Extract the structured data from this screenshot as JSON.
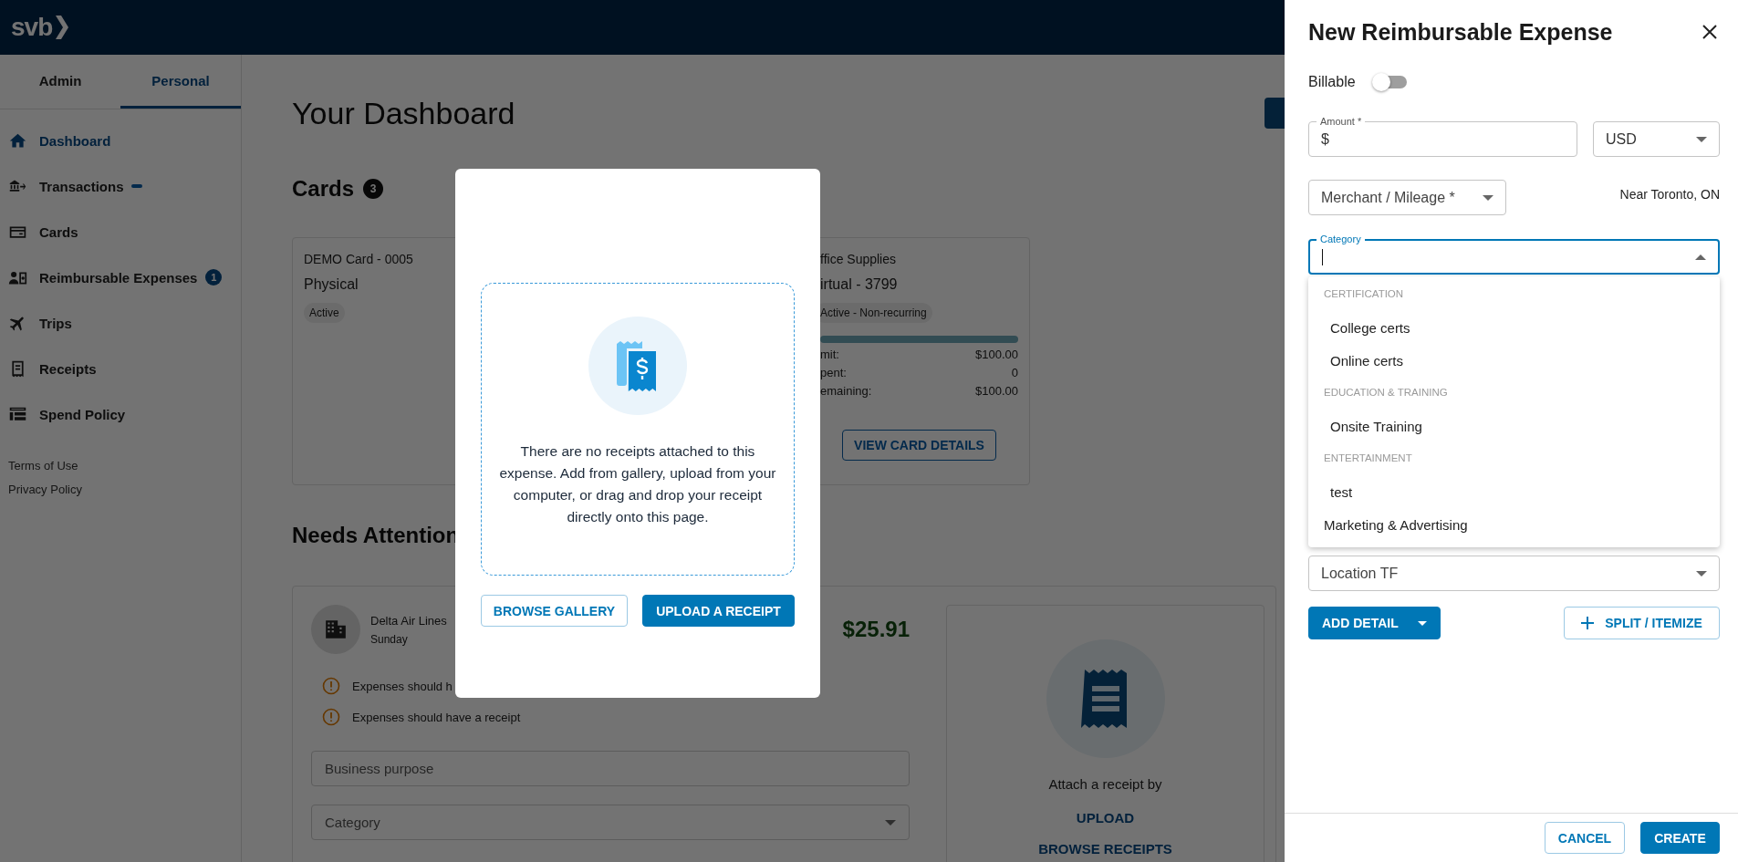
{
  "header": {
    "logo": "svb"
  },
  "sidebar": {
    "tabs": [
      {
        "label": "Admin",
        "selected": false
      },
      {
        "label": "Personal",
        "selected": true
      }
    ],
    "items": [
      {
        "label": "Dashboard",
        "selected": true
      },
      {
        "label": "Transactions",
        "selected": false,
        "pending": true
      },
      {
        "label": "Cards",
        "selected": false
      },
      {
        "label": "Reimbursable Expenses",
        "selected": false,
        "badge": "1"
      },
      {
        "label": "Trips",
        "selected": false
      },
      {
        "label": "Receipts",
        "selected": false
      },
      {
        "label": "Spend Policy",
        "selected": false
      }
    ],
    "links": [
      "Terms of Use",
      "Privacy Policy"
    ]
  },
  "dashboard": {
    "title": "Your Dashboard",
    "cards_heading": "Cards",
    "cards_count": "3",
    "cards": [
      {
        "name": "DEMO Card - 0005",
        "type": "Physical",
        "status": "Active"
      },
      {
        "name": "ffice Supplies",
        "type": "irtual - 3799",
        "status": "Active - Non-recurring",
        "rows": [
          {
            "label": "mit:",
            "value": "$100.00"
          },
          {
            "label": "pent:",
            "value": "0"
          },
          {
            "label": "emaining:",
            "value": "$100.00"
          }
        ],
        "button": "VIEW CARD DETAILS"
      }
    ],
    "needs_attention": {
      "heading": "Needs Attention",
      "merchant": "Delta Air Lines",
      "date": "Sunday",
      "amount": "$25.91",
      "warnings": [
        "Expenses should h",
        "Expenses should have a receipt"
      ],
      "fields": [
        {
          "placeholder": "Business purpose",
          "kind": "text"
        },
        {
          "placeholder": "Category",
          "kind": "select"
        }
      ],
      "attach": {
        "text": "Attach a receipt by",
        "links": [
          "UPLOAD",
          "BROWSE RECEIPTS"
        ]
      }
    }
  },
  "receipt_modal": {
    "message": "There are no receipts attached to this expense. Add from gallery, upload from your computer, or drag and drop your receipt directly onto this page.",
    "buttons": [
      {
        "label": "BROWSE GALLERY",
        "kind": "secondary"
      },
      {
        "label": "UPLOAD A RECEIPT",
        "kind": "primary"
      }
    ]
  },
  "drawer": {
    "title": "New Reimbursable Expense",
    "billable": {
      "label": "Billable",
      "on": false
    },
    "amount": {
      "label": "Amount *",
      "prefix": "$"
    },
    "currency": {
      "value": "USD"
    },
    "merchant": {
      "placeholder": "Merchant / Mileage *"
    },
    "location_hint": "Near Toronto, ON",
    "category": {
      "label": "Category",
      "focused": true,
      "options": [
        {
          "kind": "group",
          "label": "CERTIFICATION",
          "children": [
            {
              "label": "College certs"
            },
            {
              "label": "Online certs"
            }
          ]
        },
        {
          "kind": "group",
          "label": "EDUCATION & TRAINING",
          "children": [
            {
              "label": "Onsite Training"
            }
          ]
        },
        {
          "kind": "group",
          "label": "ENTERTAINMENT",
          "children": [
            {
              "label": "test"
            }
          ]
        },
        {
          "kind": "option",
          "label": "Marketing & Advertising"
        }
      ]
    },
    "location": {
      "placeholder": "Location TF"
    },
    "actions": [
      {
        "label": "ADD DETAIL",
        "kind": "dropdown"
      },
      {
        "label": "SPLIT / ITEMIZE",
        "kind": "add"
      }
    ],
    "footer": [
      {
        "label": "CANCEL",
        "kind": "secondary"
      },
      {
        "label": "CREATE",
        "kind": "primary"
      }
    ]
  }
}
